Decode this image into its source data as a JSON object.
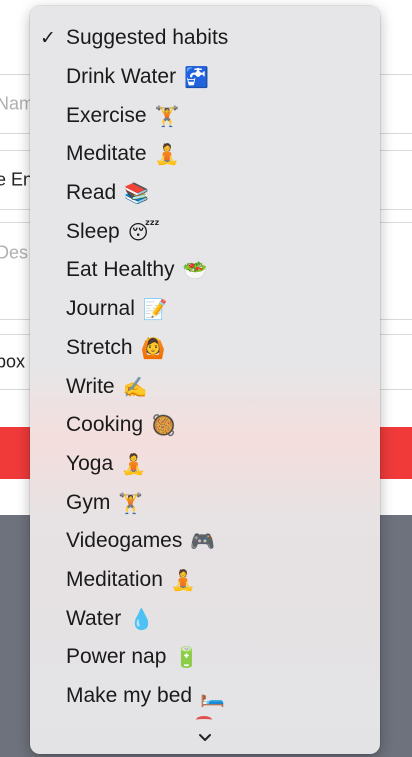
{
  "background_form": {
    "fields": [
      {
        "text": "Nam",
        "kind": "placeholder"
      },
      {
        "text": "e En",
        "kind": "value"
      },
      {
        "text": "Des",
        "kind": "placeholder"
      },
      {
        "text": "box",
        "kind": "value"
      }
    ]
  },
  "dropdown": {
    "check_glyph": "✓",
    "items": [
      {
        "label": "Suggested habits",
        "emoji": "",
        "selected": true
      },
      {
        "label": "Drink Water",
        "emoji": "🚰",
        "selected": false
      },
      {
        "label": "Exercise",
        "emoji": "🏋️",
        "selected": false
      },
      {
        "label": "Meditate",
        "emoji": "🧘",
        "selected": false
      },
      {
        "label": "Read",
        "emoji": "📚",
        "selected": false
      },
      {
        "label": "Sleep",
        "emoji": "😴",
        "selected": false
      },
      {
        "label": "Eat Healthy",
        "emoji": "🥗",
        "selected": false
      },
      {
        "label": "Journal",
        "emoji": "📝",
        "selected": false
      },
      {
        "label": "Stretch",
        "emoji": "🙆",
        "selected": false
      },
      {
        "label": "Write",
        "emoji": "✍️",
        "selected": false
      },
      {
        "label": "Cooking",
        "emoji": "🥘",
        "selected": false
      },
      {
        "label": "Yoga",
        "emoji": "🧘",
        "selected": false
      },
      {
        "label": "Gym",
        "emoji": "🏋️",
        "selected": false
      },
      {
        "label": "Videogames",
        "emoji": "🎮",
        "selected": false
      },
      {
        "label": "Meditation",
        "emoji": "🧘",
        "selected": false
      },
      {
        "label": "Water",
        "emoji": "💧",
        "selected": false
      },
      {
        "label": "Power nap",
        "emoji": "🔋",
        "selected": false
      },
      {
        "label": "Make my bed",
        "emoji": "🛏️",
        "selected": false
      }
    ],
    "scroll_down_icon": "chevron-down-icon"
  },
  "colors": {
    "submit_button_red": "#f03a3a",
    "backdrop_gray": "#6e727c",
    "menu_background": "#e6e6e8"
  }
}
